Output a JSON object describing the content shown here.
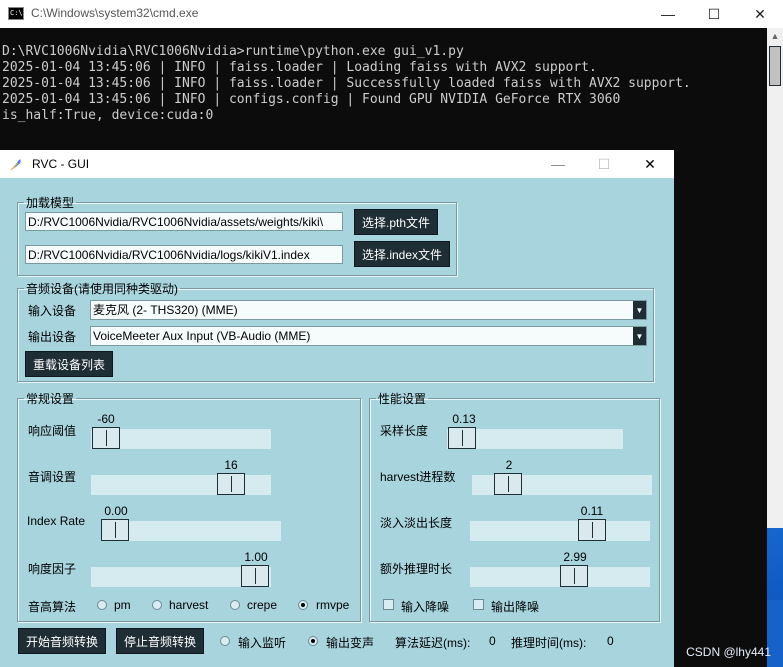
{
  "cmd": {
    "title": "C:\\Windows\\system32\\cmd.exe",
    "lines": [
      "D:\\RVC1006Nvidia\\RVC1006Nvidia>runtime\\python.exe gui_v1.py",
      "2025-01-04 13:45:06 | INFO | faiss.loader | Loading faiss with AVX2 support.",
      "2025-01-04 13:45:06 | INFO | faiss.loader | Successfully loaded faiss with AVX2 support.",
      "2025-01-04 13:45:06 | INFO | configs.config | Found GPU NVIDIA GeForce RTX 3060",
      "is_half:True, device:cuda:0"
    ]
  },
  "rvc": {
    "title": "RVC - GUI",
    "load_model": {
      "legend": "加载模型",
      "pth_path": "D:/RVC1006Nvidia/RVC1006Nvidia/assets/weights/kiki\\",
      "pth_button": "选择.pth文件",
      "index_path": "D:/RVC1006Nvidia/RVC1006Nvidia/logs/kikiV1.index",
      "index_button": "选择.index文件"
    },
    "audio_device": {
      "legend": "音频设备(请使用同种类驱动)",
      "input_label": "输入设备",
      "input_value": "麦克风 (2- THS320) (MME)",
      "output_label": "输出设备",
      "output_value": "VoiceMeeter Aux Input (VB-Audio (MME)",
      "reload_button": "重载设备列表"
    },
    "general": {
      "legend": "常规设置",
      "threshold_label": "响应阈值",
      "threshold_value": "-60",
      "pitch_label": "音调设置",
      "pitch_value": "16",
      "index_rate_label": "Index Rate",
      "index_rate_value": "0.00",
      "loudness_label": "响度因子",
      "loudness_value": "1.00",
      "algo_label": "音高算法",
      "algos": [
        "pm",
        "harvest",
        "crepe",
        "rmvpe"
      ]
    },
    "performance": {
      "legend": "性能设置",
      "sample_len_label": "采样长度",
      "sample_len_value": "0.13",
      "harvest_label": "harvest进程数",
      "harvest_value": "2",
      "crossfade_label": "淡入淡出长度",
      "crossfade_value": "0.11",
      "extra_label": "额外推理时长",
      "extra_value": "2.99",
      "in_denoise_label": "输入降噪",
      "out_denoise_label": "输出降噪"
    },
    "bottom": {
      "start_button": "开始音频转换",
      "stop_button": "停止音频转换",
      "monitor_label": "输入监听",
      "output_label": "输出变声",
      "delay_label": "算法延迟(ms):",
      "delay_value": "0",
      "infer_label": "推理时间(ms):",
      "infer_value": "0"
    }
  },
  "watermark": "CSDN @lhy441"
}
